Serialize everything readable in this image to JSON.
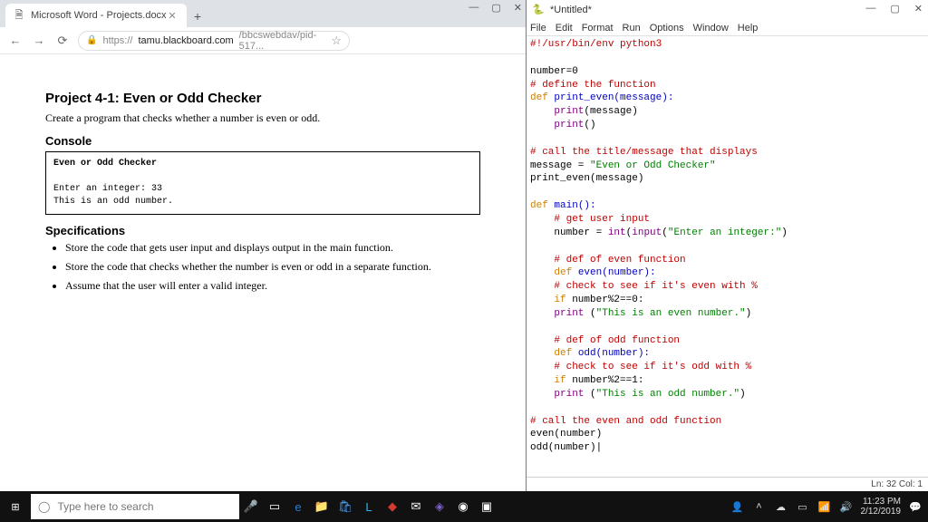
{
  "chrome": {
    "tab_title": "Microsoft Word - Projects.docx",
    "url_prefix": "https://",
    "url_host": "tamu.blackboard.com",
    "url_path": "/bbcswebdav/pid-517..."
  },
  "doc": {
    "title": "Project 4-1: Even or Odd Checker",
    "intro": "Create a program that checks whether a number is even or odd.",
    "console_heading": "Console",
    "console": {
      "l1": "Even or Odd Checker",
      "l2": "Enter an integer:  33",
      "l3": "This is an odd number."
    },
    "spec_heading": "Specifications",
    "specs": [
      "Store the code that gets user input and displays output in the main function.",
      "Store the code that checks whether the number is even or odd in a separate function.",
      "Assume that the user will enter a valid integer."
    ]
  },
  "idle": {
    "title": "*Untitled*",
    "menu": [
      "File",
      "Edit",
      "Format",
      "Run",
      "Options",
      "Window",
      "Help"
    ],
    "status": "Ln: 32  Col: 1"
  },
  "code": {
    "l01": "#!/usr/bin/env python3",
    "l02": "",
    "l03": "number=0",
    "l04": "# define the function",
    "l05_a": "def",
    "l05_b": " print_even(message):",
    "l06_a": "    print",
    "l06_b": "(message)",
    "l07_a": "    print",
    "l07_b": "()",
    "l08": "",
    "l09": "# call the title/message that displays",
    "l10_a": "message = ",
    "l10_b": "\"Even or Odd Checker\"",
    "l11": "print_even(message)",
    "l12": "",
    "l13_a": "def",
    "l13_b": " main():",
    "l14": "    # get user input",
    "l15_a": "    number = ",
    "l15_b": "int",
    "l15_c": "(",
    "l15_d": "input",
    "l15_e": "(",
    "l15_f": "\"Enter an integer:\"",
    "l15_g": ")",
    "l16": "",
    "l17": "    # def of even function",
    "l18_a": "    def",
    "l18_b": " even(number):",
    "l19": "    # check to see if it's even with %",
    "l20_a": "    if",
    "l20_b": " number%2==0:",
    "l21_a": "    print",
    "l21_b": " (",
    "l21_c": "\"This is an even number.\"",
    "l21_d": ")",
    "l22": "",
    "l23": "    # def of odd function",
    "l24_a": "    def",
    "l24_b": " odd(number):",
    "l25": "    # check to see if it's odd with %",
    "l26_a": "    if",
    "l26_b": " number%2==1:",
    "l27_a": "    print",
    "l27_b": " (",
    "l27_c": "\"This is an odd number.\"",
    "l27_d": ")",
    "l28": "",
    "l29": "# call the even and odd function",
    "l30": "even(number)",
    "l31": "odd(number)|"
  },
  "taskbar": {
    "search_placeholder": "Type here to search",
    "time": "11:23 PM",
    "date": "2/12/2019"
  }
}
